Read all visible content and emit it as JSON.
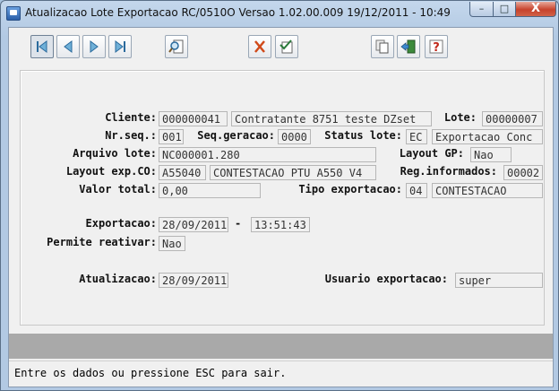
{
  "window": {
    "title": "Atualizacao  Lote Exportacao RC/0510O Versao 1.02.00.009 19/12/2011 - 10:49",
    "minimize_label": "–",
    "maximize_label": "□",
    "close_label": "X"
  },
  "toolbar": {
    "buttons": [
      "first-record",
      "previous-record",
      "next-record",
      "last-record",
      "search",
      "cancel",
      "check",
      "copy",
      "exit",
      "help"
    ]
  },
  "form": {
    "cliente": {
      "label": "Cliente:",
      "code": "000000041",
      "name": "Contratante 8751 teste DZset"
    },
    "lote": {
      "label": "Lote:",
      "value": "00000007"
    },
    "nr_seq": {
      "label": "Nr.seq.:",
      "value": "001"
    },
    "seq_geracao": {
      "label": "Seq.geracao:",
      "value": "0000"
    },
    "status_lote": {
      "label": "Status lote:",
      "code": "EC",
      "desc": "Exportacao Conc"
    },
    "arquivo_lote": {
      "label": "Arquivo lote:",
      "value": "NC000001.280"
    },
    "layout_gp": {
      "label": "Layout GP:",
      "value": "Nao"
    },
    "layout_exp": {
      "label": "Layout exp.CO:",
      "code": "A55040",
      "desc": "CONTESTACAO PTU A550 V4"
    },
    "reg_informados": {
      "label": "Reg.informados:",
      "value": "00002"
    },
    "valor_total": {
      "label": "Valor total:",
      "value": "0,00"
    },
    "tipo_exportacao": {
      "label": "Tipo exportacao:",
      "code": "04",
      "desc": "CONTESTACAO"
    },
    "exportacao": {
      "label": "Exportacao:",
      "date": "28/09/2011",
      "separator": "-",
      "time": "13:51:43"
    },
    "permite_reativar": {
      "label": "Permite reativar:",
      "value": "Nao"
    },
    "atualizacao": {
      "label": "Atualizacao:",
      "value": "28/09/2011"
    },
    "usuario_exportacao": {
      "label": "Usuario exportacao:",
      "value": "super"
    }
  },
  "status_bar": {
    "message": "Entre os dados ou pressione ESC para sair."
  }
}
